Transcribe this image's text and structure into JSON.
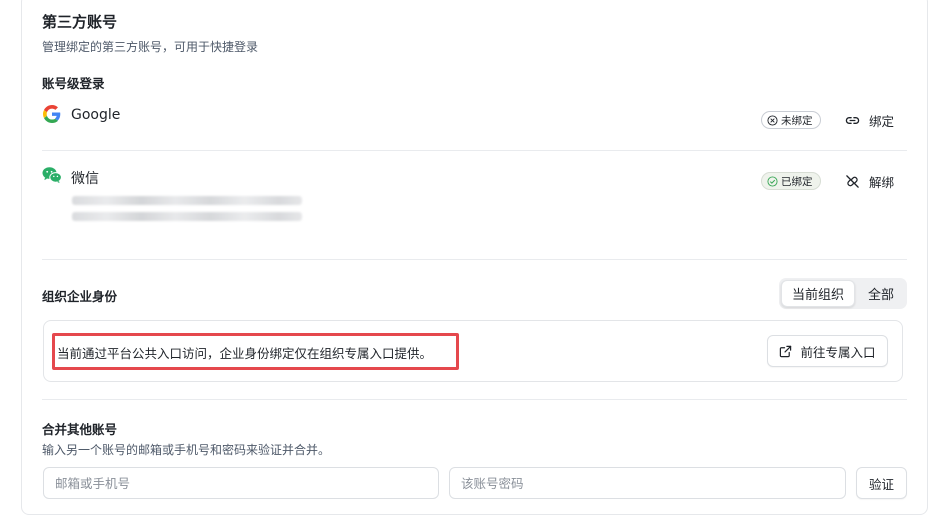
{
  "page": {
    "title": "第三方账号",
    "subtitle": "管理绑定的第三方账号，可用于快捷登录"
  },
  "account_login": {
    "section_title": "账号级登录",
    "providers": [
      {
        "name": "Google",
        "status": "未绑定",
        "action": "绑定",
        "icon": "google-icon"
      },
      {
        "name": "微信",
        "status": "已绑定",
        "action": "解绑",
        "icon": "wechat-icon"
      }
    ]
  },
  "org_identity": {
    "section_title": "组织企业身份",
    "tabs": [
      "当前组织",
      "全部"
    ],
    "active_tab": "当前组织",
    "notice": "当前通过平台公共入口访问，企业身份绑定仅在组织专属入口提供。",
    "entry_button": "前往专属入口"
  },
  "merge": {
    "section_title": "合并其他账号",
    "description": "输入另一个账号的邮箱或手机号和密码来验证并合并。",
    "account_placeholder": "邮箱或手机号",
    "password_placeholder": "该账号密码",
    "verify_button": "验证"
  },
  "colors": {
    "highlight_border": "#e5484d",
    "bound_badge_bg": "#eff3ec",
    "wechat_green": "#2aae67",
    "check_green": "#3aa757"
  }
}
